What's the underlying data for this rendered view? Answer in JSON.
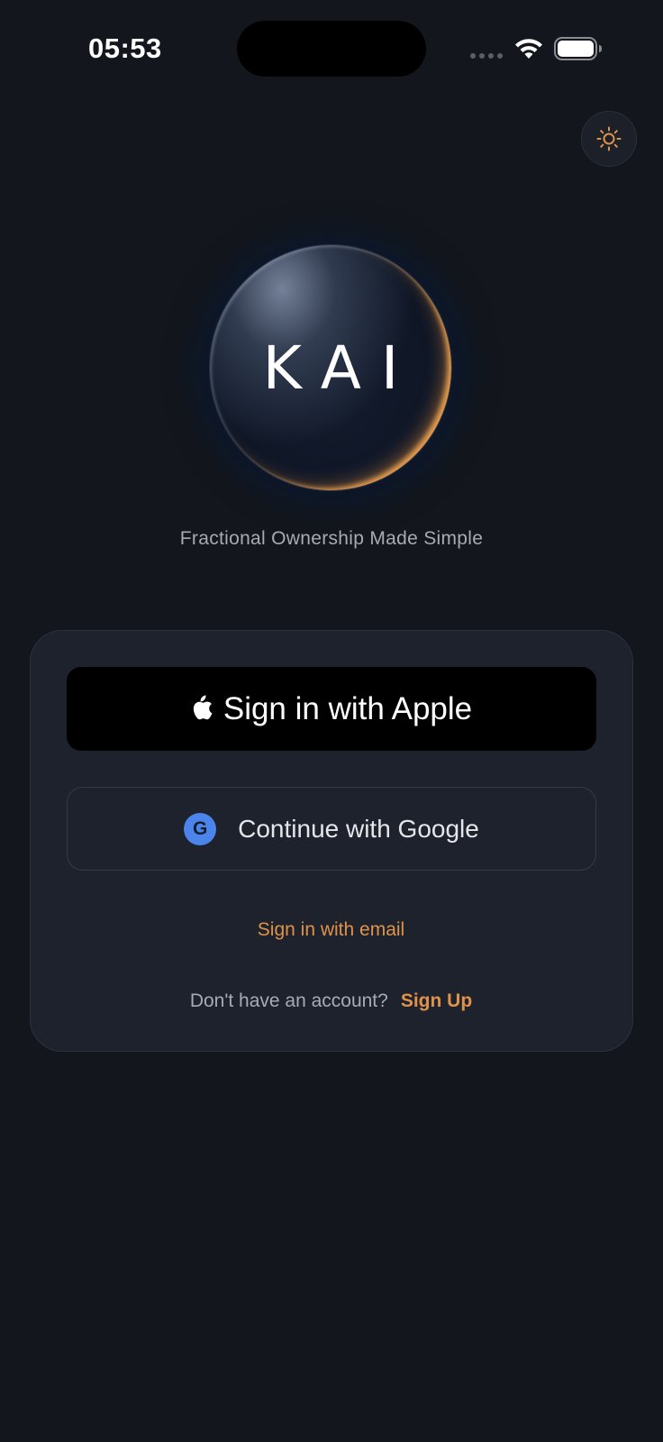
{
  "status_bar": {
    "time": "05:53"
  },
  "theme_toggle": {
    "icon": "sun-icon"
  },
  "brand": {
    "logo_text": "KAI",
    "tagline": "Fractional Ownership Made Simple"
  },
  "auth": {
    "apple_label": "Sign in with Apple",
    "google_label": "Continue with Google",
    "google_icon_letter": "G",
    "email_label": "Sign in with email",
    "signup_prompt": "Don't have an account?",
    "signup_label": "Sign Up"
  },
  "colors": {
    "background": "#13161c",
    "card": "#1d222c",
    "accent": "#e0924a",
    "google_blue": "#4b84ea"
  }
}
